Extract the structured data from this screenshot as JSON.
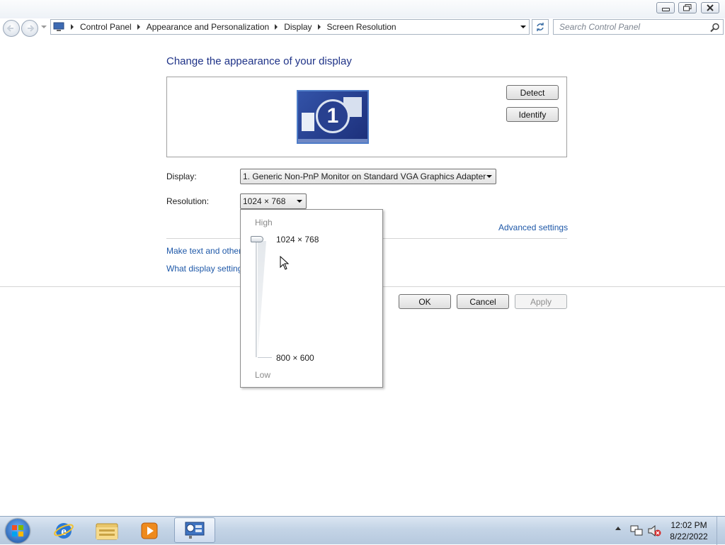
{
  "window": {
    "buttons": {
      "minimize": "minimize",
      "restore": "restore",
      "close": "close"
    }
  },
  "address_bar": {
    "breadcrumbs": [
      "Control Panel",
      "Appearance and Personalization",
      "Display",
      "Screen Resolution"
    ],
    "search_placeholder": "Search Control Panel"
  },
  "main": {
    "heading": "Change the appearance of your display",
    "monitor_number": "1",
    "detect_label": "Detect",
    "identify_label": "Identify",
    "display_label": "Display:",
    "display_value": "1. Generic Non-PnP Monitor on Standard VGA Graphics Adapter",
    "resolution_label": "Resolution:",
    "resolution_value": "1024 × 768",
    "advanced_link": "Advanced settings",
    "link_text_size": "Make text and other",
    "link_display_settings": "What display setting",
    "ok_label": "OK",
    "cancel_label": "Cancel",
    "apply_label": "Apply"
  },
  "resolution_dropdown": {
    "high_label": "High",
    "low_label": "Low",
    "max_option": "1024 × 768",
    "min_option": "800 × 600",
    "slider_value": 1.0
  },
  "taskbar": {
    "items": [
      "start-orb",
      "internet-explorer",
      "windows-explorer",
      "media-player",
      "control-panel"
    ],
    "time": "12:02 PM",
    "date": "8/22/2022"
  },
  "colors": {
    "heading": "#1e3287",
    "link": "#1e58a8",
    "taskbar": "#c4d4e6"
  }
}
